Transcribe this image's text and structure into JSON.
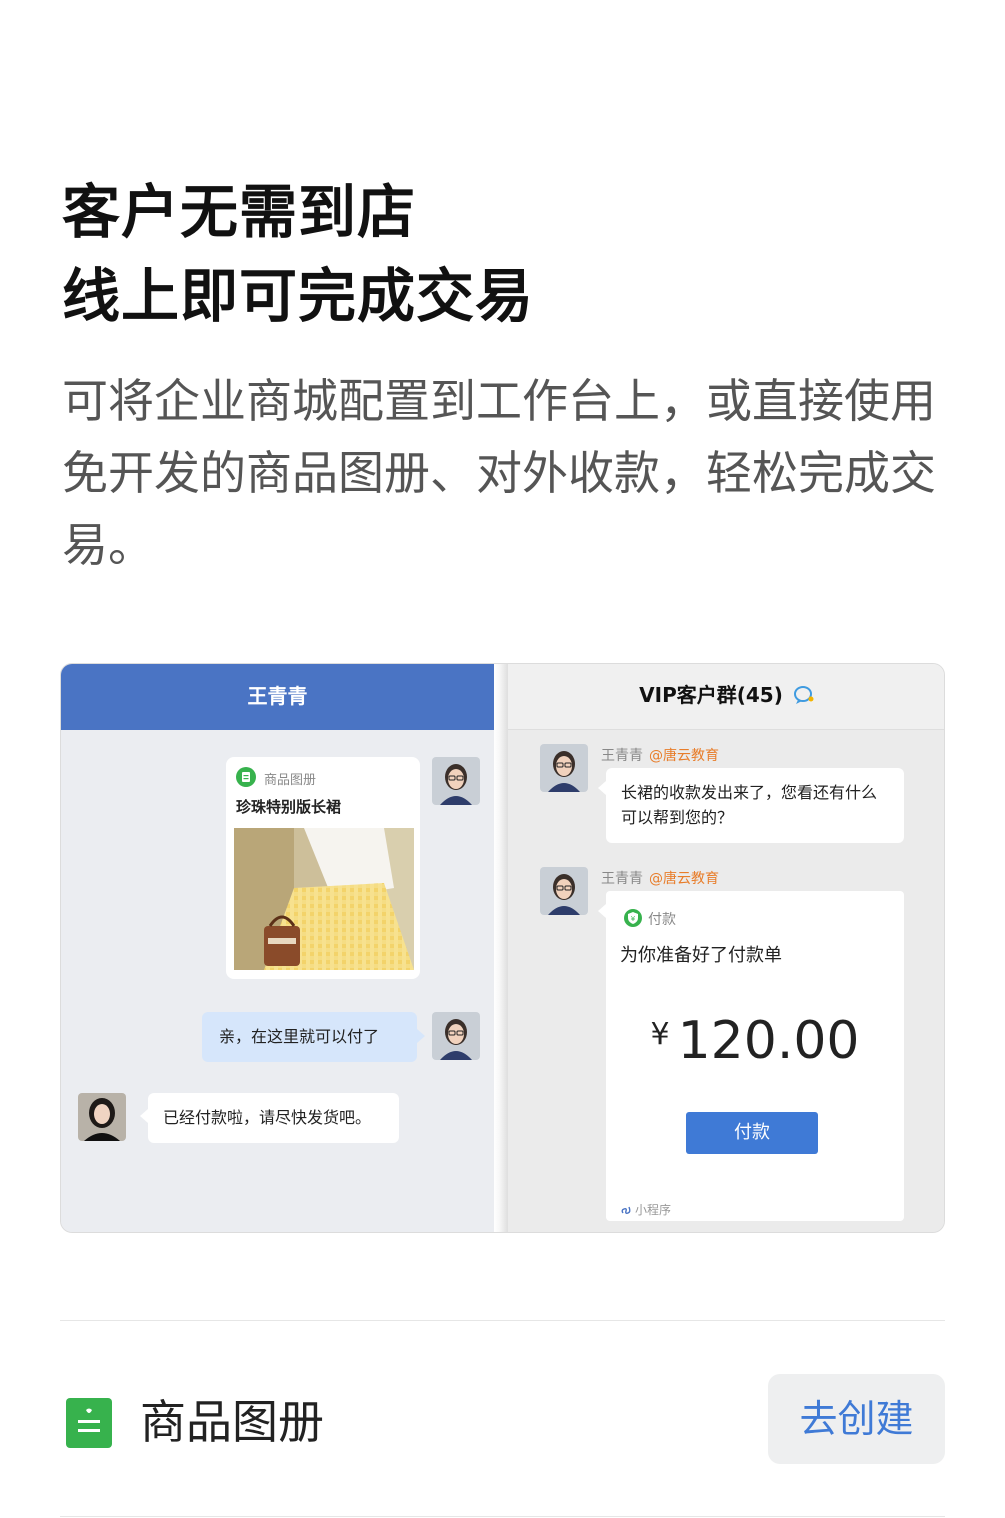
{
  "headline": {
    "line1": "客户无需到店",
    "line2": "线上即可完成交易"
  },
  "description": "可将企业商城配置到工作台上，或直接使用免开发的商品图册、对外收款，轻松完成交易。",
  "mockup": {
    "left_chat": {
      "title": "王青青",
      "product_card": {
        "label": "商品图册",
        "title": "珍珠特别版长裙"
      },
      "my_message": "亲，在这里就可以付了",
      "customer_message": "已经付款啦，请尽快发货吧。"
    },
    "right_chat": {
      "title": "VIP客户群(45)",
      "msg1": {
        "sender": "王青青",
        "org": "@唐云教育",
        "text": "长裙的收款发出来了，您看还有什么可以帮到您的？"
      },
      "msg2": {
        "sender": "王青青",
        "org": "@唐云教育",
        "card_label": "付款",
        "card_title": "为你准备好了付款单",
        "currency": "¥",
        "amount": "120.00",
        "pay_button": "付款",
        "mini_program_label": "小程序"
      }
    }
  },
  "bottom": {
    "label": "商品图册",
    "create_button": "去创建"
  },
  "colors": {
    "accent_blue": "#4a74c4",
    "brand_green": "#37b24d",
    "org_orange": "#e87d2a"
  }
}
